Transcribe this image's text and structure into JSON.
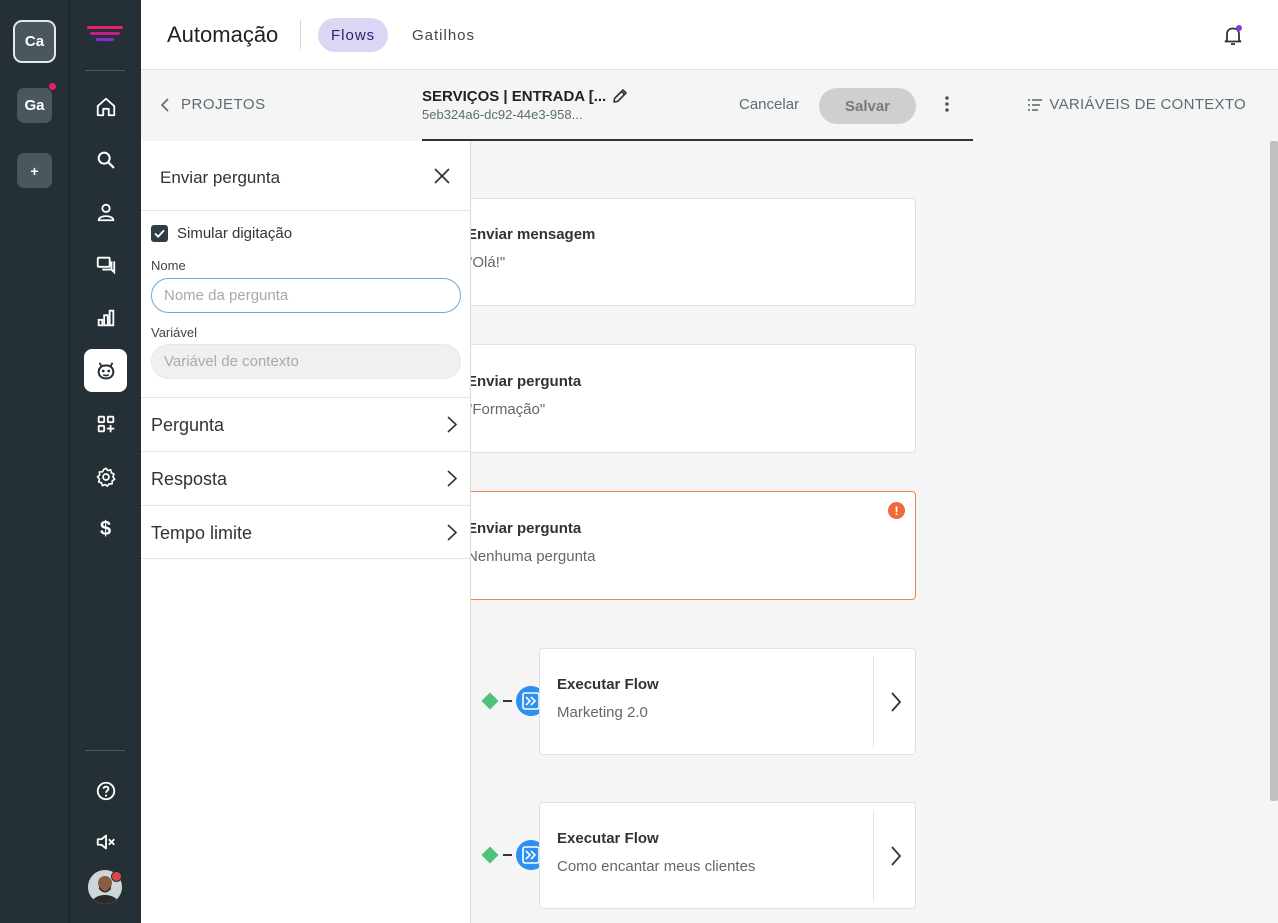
{
  "workspaces": [
    {
      "initials": "Ca",
      "active": true
    },
    {
      "initials": "Ga",
      "active": false,
      "notification": true
    },
    {
      "initials": "+",
      "active": false
    }
  ],
  "header": {
    "title": "Automação",
    "tabs": [
      {
        "label": "Flows",
        "active": true
      },
      {
        "label": "Gatilhos",
        "active": false
      }
    ]
  },
  "subheader": {
    "back_label": "PROJETOS",
    "flow_name": "SERVIÇOS | ENTRADA [...",
    "flow_id": "5eb324a6-dc92-44e3-958...",
    "cancel_label": "Cancelar",
    "save_label": "Salvar",
    "context_vars_label": "VARIÁVEIS DE CONTEXTO"
  },
  "panel": {
    "title": "Enviar pergunta",
    "simulate_typing_label": "Simular digitação",
    "simulate_typing_checked": true,
    "name_label": "Nome",
    "name_placeholder": "Nome da pergunta",
    "name_value": "",
    "variable_label": "Variável",
    "variable_placeholder": "Variável de contexto",
    "sections": [
      {
        "label": "Pergunta"
      },
      {
        "label": "Resposta"
      },
      {
        "label": "Tempo limite"
      }
    ]
  },
  "canvas": {
    "cards": [
      {
        "title": "Enviar mensagem",
        "subtitle": "\"Olá!\"",
        "error": false
      },
      {
        "title": "Enviar pergunta",
        "subtitle": "\"Formação\"",
        "error": false
      },
      {
        "title": "Enviar pergunta",
        "subtitle": "Nenhuma pergunta",
        "error": true
      }
    ],
    "flow_cards": [
      {
        "title": "Executar Flow",
        "subtitle": "Marketing 2.0"
      },
      {
        "title": "Executar Flow",
        "subtitle": "Como encantar meus clientes"
      }
    ]
  },
  "colors": {
    "rail": "#243036",
    "accent_tab": "#dcd6f5",
    "error": "#ef6a3a",
    "flow_icon": "#2d8ff0",
    "condition_diamond": "#4cc27a"
  }
}
